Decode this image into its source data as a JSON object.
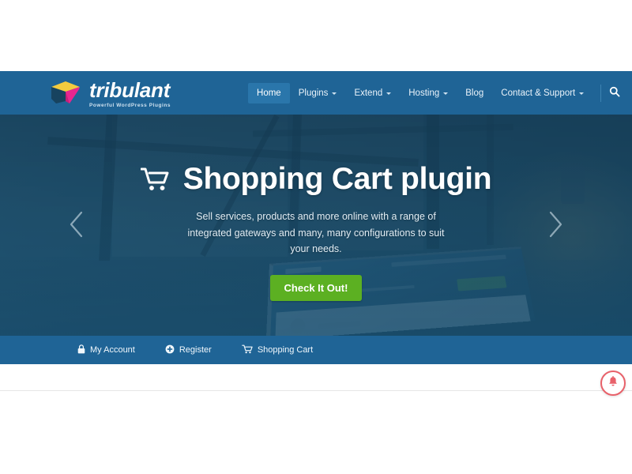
{
  "brand": {
    "name": "tribulant",
    "tagline": "Powerful WordPress Plugins",
    "logo_icon": "tribulant-cube-logo",
    "colors": {
      "gold": "#f2cb3f",
      "magenta": "#e8268f",
      "navy": "#17435f"
    }
  },
  "header": {
    "background": "#1f6496",
    "nav": [
      {
        "label": "Home",
        "has_dropdown": false,
        "active": true
      },
      {
        "label": "Plugins",
        "has_dropdown": true,
        "active": false
      },
      {
        "label": "Extend",
        "has_dropdown": true,
        "active": false
      },
      {
        "label": "Hosting",
        "has_dropdown": true,
        "active": false
      },
      {
        "label": "Blog",
        "has_dropdown": false,
        "active": false
      },
      {
        "label": "Contact & Support",
        "has_dropdown": true,
        "active": false
      }
    ],
    "search_icon": "search-icon"
  },
  "hero": {
    "icon": "shopping-cart-icon",
    "title": "Shopping Cart plugin",
    "subtitle": "Sell services, products and more online with a range of integrated gateways and many, many configurations to suit your needs.",
    "cta_label": "Check It Out!",
    "cta_color": "#5cb022",
    "prev_arrow_icon": "chevron-left-icon",
    "next_arrow_icon": "chevron-right-icon",
    "background_image_caption": "Office workspace with laptop showing a blog page"
  },
  "utility_bar": {
    "background": "#1f6496",
    "links": [
      {
        "label": "My Account",
        "icon": "lock-icon"
      },
      {
        "label": "Register",
        "icon": "plus-circle-icon"
      },
      {
        "label": "Shopping Cart",
        "icon": "shopping-cart-icon"
      }
    ]
  },
  "widgets": {
    "notification": {
      "icon": "bell-icon",
      "color": "#e8616a"
    }
  }
}
